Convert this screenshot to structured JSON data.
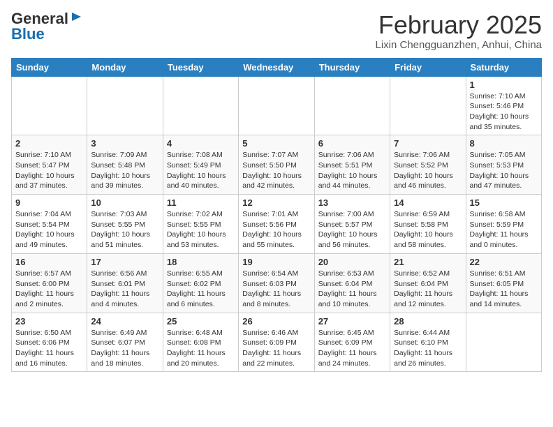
{
  "logo": {
    "general": "General",
    "blue": "Blue"
  },
  "header": {
    "month": "February 2025",
    "location": "Lixin Chengguanzhen, Anhui, China"
  },
  "weekdays": [
    "Sunday",
    "Monday",
    "Tuesday",
    "Wednesday",
    "Thursday",
    "Friday",
    "Saturday"
  ],
  "weeks": [
    [
      {
        "day": "",
        "info": ""
      },
      {
        "day": "",
        "info": ""
      },
      {
        "day": "",
        "info": ""
      },
      {
        "day": "",
        "info": ""
      },
      {
        "day": "",
        "info": ""
      },
      {
        "day": "",
        "info": ""
      },
      {
        "day": "1",
        "info": "Sunrise: 7:10 AM\nSunset: 5:46 PM\nDaylight: 10 hours\nand 35 minutes."
      }
    ],
    [
      {
        "day": "2",
        "info": "Sunrise: 7:10 AM\nSunset: 5:47 PM\nDaylight: 10 hours\nand 37 minutes."
      },
      {
        "day": "3",
        "info": "Sunrise: 7:09 AM\nSunset: 5:48 PM\nDaylight: 10 hours\nand 39 minutes."
      },
      {
        "day": "4",
        "info": "Sunrise: 7:08 AM\nSunset: 5:49 PM\nDaylight: 10 hours\nand 40 minutes."
      },
      {
        "day": "5",
        "info": "Sunrise: 7:07 AM\nSunset: 5:50 PM\nDaylight: 10 hours\nand 42 minutes."
      },
      {
        "day": "6",
        "info": "Sunrise: 7:06 AM\nSunset: 5:51 PM\nDaylight: 10 hours\nand 44 minutes."
      },
      {
        "day": "7",
        "info": "Sunrise: 7:06 AM\nSunset: 5:52 PM\nDaylight: 10 hours\nand 46 minutes."
      },
      {
        "day": "8",
        "info": "Sunrise: 7:05 AM\nSunset: 5:53 PM\nDaylight: 10 hours\nand 47 minutes."
      }
    ],
    [
      {
        "day": "9",
        "info": "Sunrise: 7:04 AM\nSunset: 5:54 PM\nDaylight: 10 hours\nand 49 minutes."
      },
      {
        "day": "10",
        "info": "Sunrise: 7:03 AM\nSunset: 5:55 PM\nDaylight: 10 hours\nand 51 minutes."
      },
      {
        "day": "11",
        "info": "Sunrise: 7:02 AM\nSunset: 5:55 PM\nDaylight: 10 hours\nand 53 minutes."
      },
      {
        "day": "12",
        "info": "Sunrise: 7:01 AM\nSunset: 5:56 PM\nDaylight: 10 hours\nand 55 minutes."
      },
      {
        "day": "13",
        "info": "Sunrise: 7:00 AM\nSunset: 5:57 PM\nDaylight: 10 hours\nand 56 minutes."
      },
      {
        "day": "14",
        "info": "Sunrise: 6:59 AM\nSunset: 5:58 PM\nDaylight: 10 hours\nand 58 minutes."
      },
      {
        "day": "15",
        "info": "Sunrise: 6:58 AM\nSunset: 5:59 PM\nDaylight: 11 hours\nand 0 minutes."
      }
    ],
    [
      {
        "day": "16",
        "info": "Sunrise: 6:57 AM\nSunset: 6:00 PM\nDaylight: 11 hours\nand 2 minutes."
      },
      {
        "day": "17",
        "info": "Sunrise: 6:56 AM\nSunset: 6:01 PM\nDaylight: 11 hours\nand 4 minutes."
      },
      {
        "day": "18",
        "info": "Sunrise: 6:55 AM\nSunset: 6:02 PM\nDaylight: 11 hours\nand 6 minutes."
      },
      {
        "day": "19",
        "info": "Sunrise: 6:54 AM\nSunset: 6:03 PM\nDaylight: 11 hours\nand 8 minutes."
      },
      {
        "day": "20",
        "info": "Sunrise: 6:53 AM\nSunset: 6:04 PM\nDaylight: 11 hours\nand 10 minutes."
      },
      {
        "day": "21",
        "info": "Sunrise: 6:52 AM\nSunset: 6:04 PM\nDaylight: 11 hours\nand 12 minutes."
      },
      {
        "day": "22",
        "info": "Sunrise: 6:51 AM\nSunset: 6:05 PM\nDaylight: 11 hours\nand 14 minutes."
      }
    ],
    [
      {
        "day": "23",
        "info": "Sunrise: 6:50 AM\nSunset: 6:06 PM\nDaylight: 11 hours\nand 16 minutes."
      },
      {
        "day": "24",
        "info": "Sunrise: 6:49 AM\nSunset: 6:07 PM\nDaylight: 11 hours\nand 18 minutes."
      },
      {
        "day": "25",
        "info": "Sunrise: 6:48 AM\nSunset: 6:08 PM\nDaylight: 11 hours\nand 20 minutes."
      },
      {
        "day": "26",
        "info": "Sunrise: 6:46 AM\nSunset: 6:09 PM\nDaylight: 11 hours\nand 22 minutes."
      },
      {
        "day": "27",
        "info": "Sunrise: 6:45 AM\nSunset: 6:09 PM\nDaylight: 11 hours\nand 24 minutes."
      },
      {
        "day": "28",
        "info": "Sunrise: 6:44 AM\nSunset: 6:10 PM\nDaylight: 11 hours\nand 26 minutes."
      },
      {
        "day": "",
        "info": ""
      }
    ]
  ]
}
